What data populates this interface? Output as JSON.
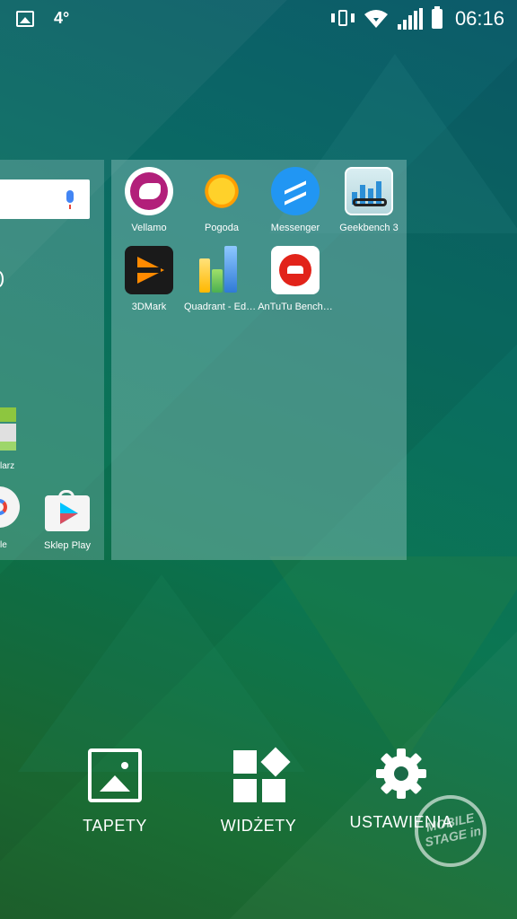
{
  "status_bar": {
    "temperature": "4°",
    "time": "06:16"
  },
  "left_page": {
    "label_fragment_1": "larz",
    "label_fragment_2": "le",
    "play_store_label": "Sklep Play"
  },
  "folder_apps": [
    {
      "label": "Vellamo",
      "icon": "vellamo-icon"
    },
    {
      "label": "Pogoda",
      "icon": "weather-icon"
    },
    {
      "label": "Messenger",
      "icon": "messenger-icon"
    },
    {
      "label": "Geekbench 3",
      "icon": "geekbench-icon"
    },
    {
      "label": "3DMark",
      "icon": "3dmark-icon"
    },
    {
      "label": "Quadrant - Edyc…",
      "icon": "quadrant-icon"
    },
    {
      "label": "AnTuTu Bench…",
      "icon": "antutu-icon"
    }
  ],
  "bottom_options": {
    "wallpapers": "TAPETY",
    "widgets": "WIDŻETY",
    "settings": "USTAWIENIA"
  },
  "watermark": {
    "line1": "MOBILE",
    "line2": "STAGE",
    "suffix": "in"
  },
  "colors": {
    "background_top": "#0c5b6a",
    "background_bottom": "#1d5e2b",
    "messenger_blue": "#2196f3",
    "antutu_red": "#e2231a"
  }
}
